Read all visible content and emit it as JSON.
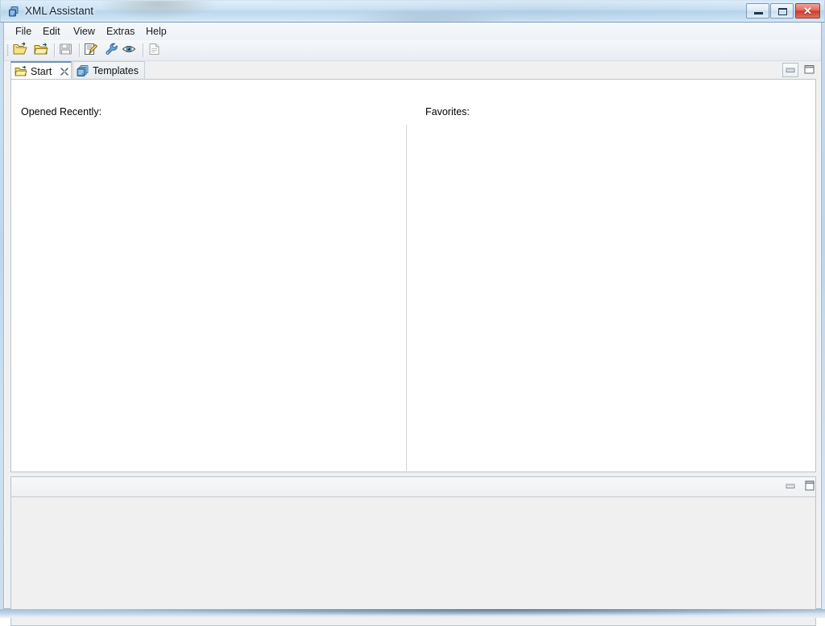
{
  "window": {
    "title": "XML Assistant",
    "app_icon": "xml-documents-icon",
    "controls": {
      "minimize_label": "–",
      "maximize_label": "□",
      "close_label": "✕"
    },
    "colors": {
      "close_button": "#c63d2c",
      "glass_blue": "#b2d2ec",
      "chrome": "#f0f0f0",
      "editor_background": "#ffffff",
      "border": "#b8c4cf"
    }
  },
  "menubar": {
    "items": [
      {
        "label": "File"
      },
      {
        "label": "Edit"
      },
      {
        "label": "View"
      },
      {
        "label": "Extras"
      },
      {
        "label": "Help"
      }
    ]
  },
  "toolbar": {
    "buttons": [
      {
        "name": "open-file-icon",
        "title": "Open",
        "enabled": true
      },
      {
        "name": "open-folder-icon",
        "title": "Open Folder",
        "enabled": true
      },
      {
        "name": "save-icon",
        "title": "Save",
        "enabled": false
      },
      {
        "name": "edit-document-icon",
        "title": "Edit",
        "enabled": true
      },
      {
        "name": "wrench-icon",
        "title": "Tools",
        "enabled": true
      },
      {
        "name": "eye-icon",
        "title": "Preview",
        "enabled": true
      },
      {
        "name": "new-document-icon",
        "title": "New Document",
        "enabled": false
      }
    ]
  },
  "tabs": {
    "items": [
      {
        "label": "Start",
        "icon": "open-folder-icon",
        "active": true,
        "closable": true
      },
      {
        "label": "Templates",
        "icon": "templates-windows-icon",
        "active": false,
        "closable": false
      }
    ]
  },
  "editor": {
    "view_controls": [
      {
        "name": "minimize-view-button",
        "glyph": "minimize"
      },
      {
        "name": "maximize-view-button",
        "glyph": "maximize"
      }
    ],
    "columns": {
      "left_heading": "Opened Recently:",
      "right_heading": "Favorites:",
      "left_items": [],
      "right_items": []
    }
  },
  "bottom_panel": {
    "view_controls": [
      {
        "name": "minimize-view-button",
        "glyph": "minimize"
      },
      {
        "name": "maximize-view-button",
        "glyph": "maximize"
      }
    ],
    "content": ""
  }
}
